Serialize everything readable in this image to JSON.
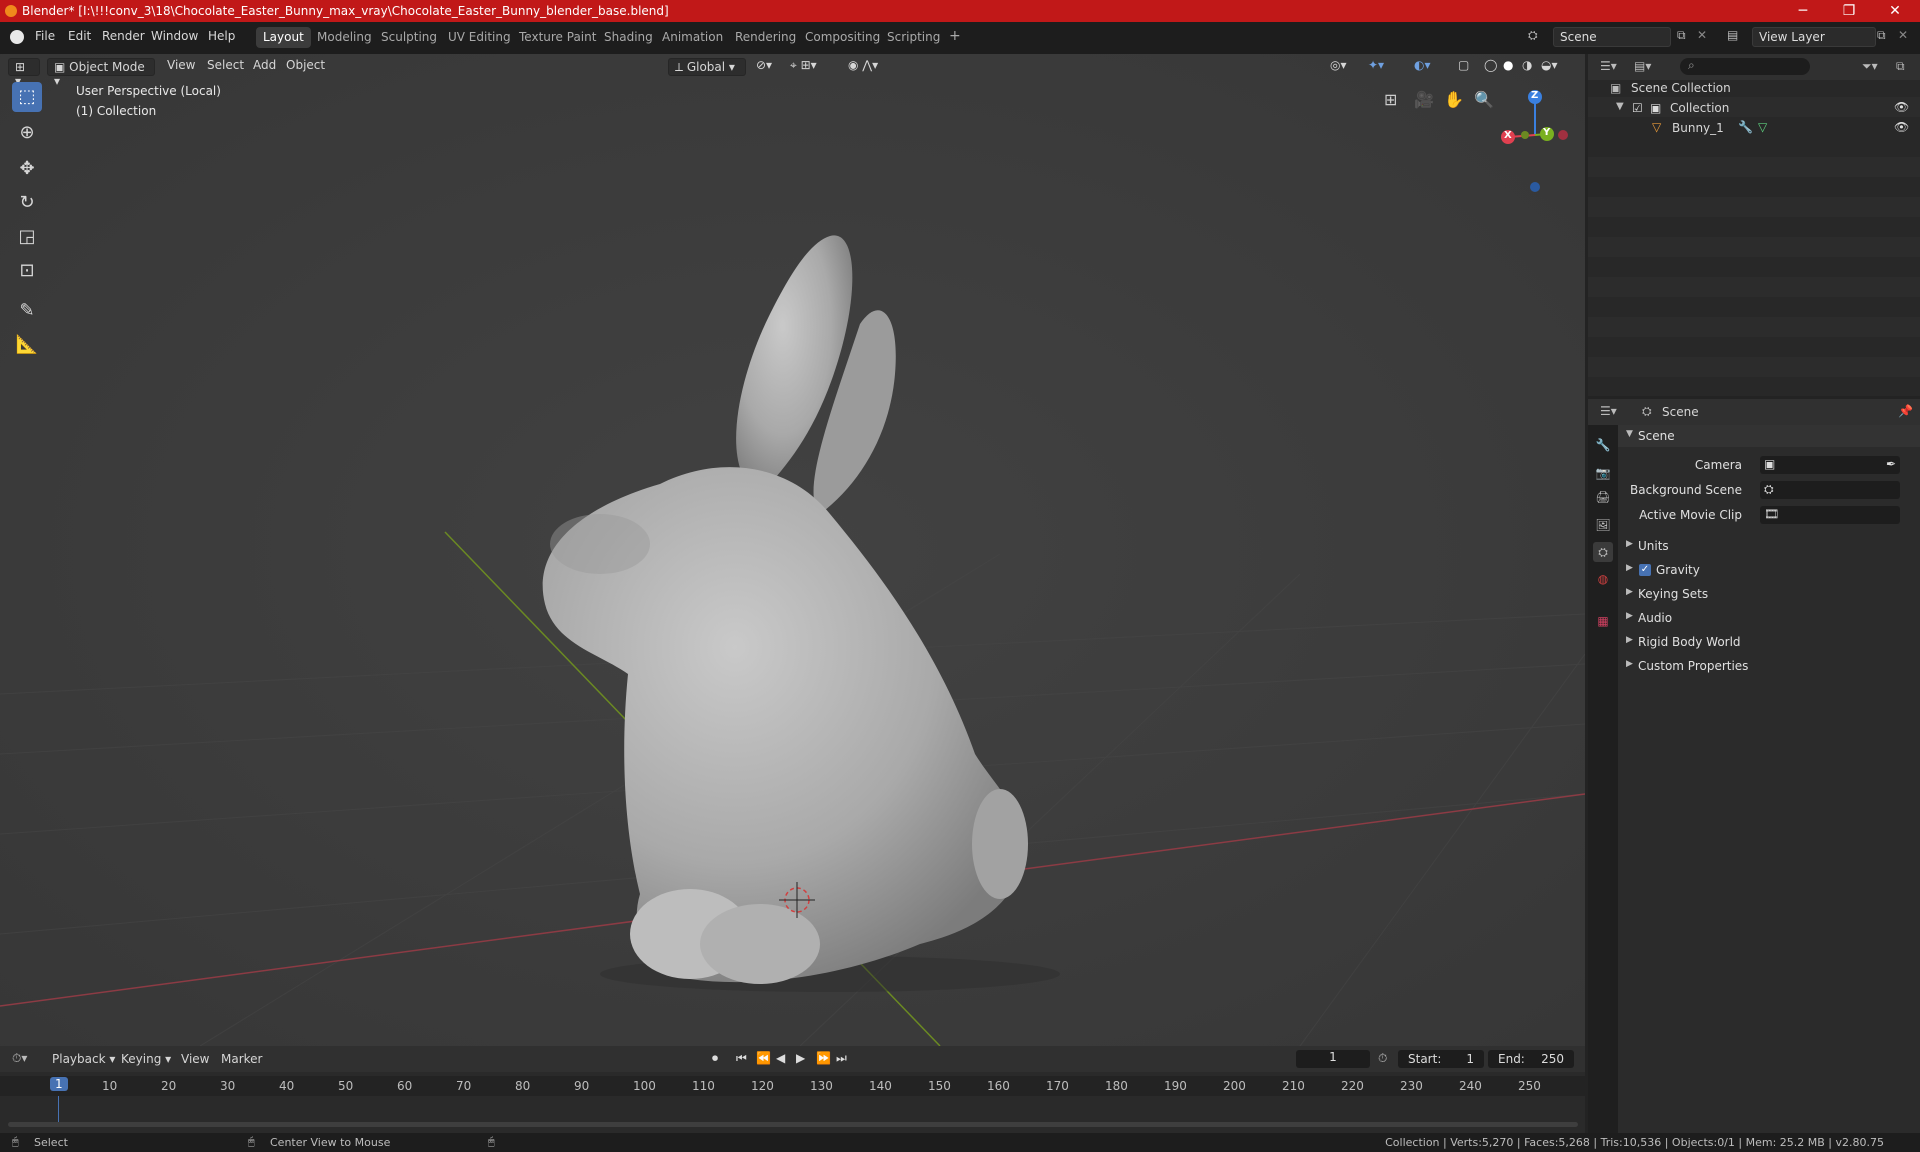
{
  "window": {
    "title": "Blender* [I:\\!!!conv_3\\18\\Chocolate_Easter_Bunny_max_vray\\Chocolate_Easter_Bunny_blender_base.blend]",
    "minimize": "─",
    "maximize": "❐",
    "close": "✕"
  },
  "menubar": {
    "items": [
      "File",
      "Edit",
      "Render",
      "Window",
      "Help"
    ],
    "workspaces": [
      "Layout",
      "Modeling",
      "Sculpting",
      "UV Editing",
      "Texture Paint",
      "Shading",
      "Animation",
      "Rendering",
      "Compositing",
      "Scripting"
    ],
    "active_workspace": "Layout",
    "add_tab": "+",
    "scene": "Scene",
    "view_layer": "View Layer"
  },
  "viewport": {
    "mode": "Object Mode",
    "menus": [
      "View",
      "Select",
      "Add",
      "Object"
    ],
    "orientation": "Global",
    "perspective_label": "User Perspective (Local)",
    "collection_label": "(1) Collection",
    "gizmo": {
      "x": "X",
      "y": "Y",
      "z": "Z"
    }
  },
  "outliner": {
    "root": "Scene Collection",
    "collection": "Collection",
    "object": "Bunny_1"
  },
  "properties": {
    "header": "Scene",
    "panel": "Scene",
    "camera_label": "Camera",
    "background_scene_label": "Background Scene",
    "active_movie_clip_label": "Active Movie Clip",
    "sections": [
      "Units",
      "Gravity",
      "Keying Sets",
      "Audio",
      "Rigid Body World",
      "Custom Properties"
    ]
  },
  "timeline": {
    "menus": [
      "Playback",
      "Keying",
      "View",
      "Marker"
    ],
    "current_frame": "1",
    "start_label": "Start:",
    "start": "1",
    "end_label": "End:",
    "end": "250",
    "ticks": [
      "1",
      "10",
      "20",
      "30",
      "40",
      "50",
      "60",
      "70",
      "80",
      "90",
      "100",
      "110",
      "120",
      "130",
      "140",
      "150",
      "160",
      "170",
      "180",
      "190",
      "200",
      "210",
      "220",
      "230",
      "240",
      "250"
    ]
  },
  "statusbar": {
    "select": "Select",
    "center_view": "Center View to Mouse",
    "stats": "Collection | Verts:5,270 | Faces:5,268 | Tris:10,536 | Objects:0/1 | Mem: 25.2 MB | v2.80.75"
  },
  "colors": {
    "title_bar": "#c11818",
    "accent": "#4772b3",
    "x_axis": "#e04050",
    "y_axis": "#7ab020",
    "z_axis": "#3a80e0"
  }
}
